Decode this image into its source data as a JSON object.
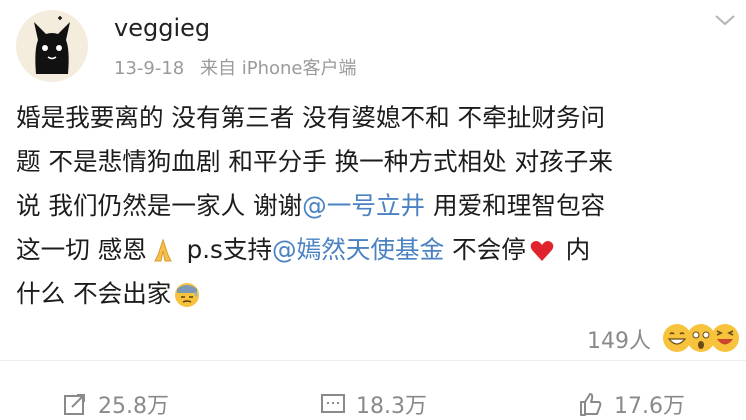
{
  "post": {
    "username": "veggieg",
    "date": "13-9-18",
    "source": "来自 iPhone客户端",
    "lines": [
      {
        "text": "婚是我要离的 没有第三者 没有婆媳不和 不牵扯财务问"
      },
      {
        "text": "题 不是悲情狗血剧 和平分手 换一种方式相处 对孩子来"
      },
      {
        "pre": "说 我们仍然是一家人 谢谢",
        "mention": "@一号立井",
        "post": " 用爱和理智包容"
      },
      {
        "pre": "这一切 感恩",
        "mid": " p.s支持",
        "mention": "@嫣然天使基金",
        "post": " 不会停",
        "tail": " 内"
      },
      {
        "text": "什么 不会出家"
      }
    ],
    "emojis": [
      "folded-hands",
      "red-heart",
      "downcast-sweat-face"
    ],
    "likes": "149人",
    "reaction_emojis": [
      "grinning-face",
      "surprised-face",
      "laughing-face"
    ]
  },
  "actions": {
    "repost": "25.8万",
    "comment": "18.3万",
    "like": "17.6万"
  }
}
